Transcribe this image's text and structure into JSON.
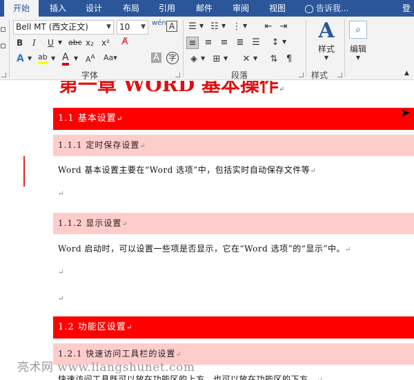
{
  "tabs": [
    {
      "id": "home",
      "label": "开始",
      "active": true
    },
    {
      "id": "insert",
      "label": "插入"
    },
    {
      "id": "design",
      "label": "设计"
    },
    {
      "id": "layout",
      "label": "布局"
    },
    {
      "id": "references",
      "label": "引用"
    },
    {
      "id": "mailings",
      "label": "邮件"
    },
    {
      "id": "review",
      "label": "审阅"
    },
    {
      "id": "view",
      "label": "视图"
    }
  ],
  "tell_me": "告诉我...",
  "sign_in": "登",
  "ribbon": {
    "font_name": "Bell MT (西文正文)",
    "font_size": "10",
    "phonetic": "wén",
    "group_font": "字体",
    "group_paragraph": "段落",
    "group_styles": "样式",
    "styles_label": "样式",
    "edit_label": "编辑",
    "bold": "B",
    "italic": "I",
    "underline": "U",
    "strike": "abc",
    "subscript": "x₂",
    "superscript": "x²",
    "text_effect": "A",
    "highlight": "ab",
    "font_color": "A",
    "char_shading": "A",
    "enclose_char": "字"
  },
  "document": {
    "chapter_title": "第一章 WORD 基本操作",
    "paragraph_mark": "↵",
    "headings": {
      "h1_1": "1.1  基本设置",
      "h2_1_1": "1.1.1  定时保存设置",
      "h2_1_2": "1.1.2  显示设置",
      "h1_2": "1.2  功能区设置",
      "h2_2_1": "1.2.1  快速访问工具栏的设置"
    },
    "paragraphs": {
      "p1": "Word 基本设置主要在“Word 选项”中，包括实时自动保存文件等",
      "p2": "Word 启动时，可以设置一些项是否显示，它在“Word 选项”的“显示”中。",
      "p3": "快速访问工具既可以放在功能区的上方，也可以放在功能区的下方。"
    }
  },
  "watermark": "亮术网 www.liangshunet.com"
}
